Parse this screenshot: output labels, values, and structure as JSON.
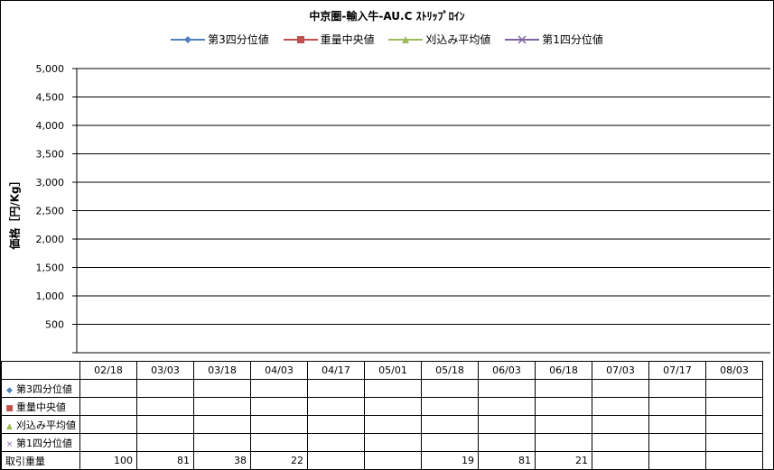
{
  "chart_data": {
    "type": "line",
    "title": "中京圏-輸入牛-AU.C ｽﾄﾘｯﾌﾟﾛｲﾝ",
    "ylabel": "価格［円/Kg］",
    "ylim": [
      0,
      5000
    ],
    "yticks": [
      500,
      1000,
      1500,
      2000,
      2500,
      3000,
      3500,
      4000,
      4500,
      5000
    ],
    "yticks_labels": [
      "500",
      "1,000",
      "1,500",
      "2,000",
      "2,500",
      "3,000",
      "3,500",
      "4,000",
      "4,500",
      "5,000"
    ],
    "categories": [
      "02/18",
      "03/03",
      "03/18",
      "04/03",
      "04/17",
      "05/01",
      "05/18",
      "06/03",
      "06/18",
      "07/03",
      "07/17",
      "08/03"
    ],
    "series": [
      {
        "name": "第3四分位値",
        "color": "#4F81BD",
        "marker": "◆",
        "values": [
          null,
          null,
          null,
          null,
          null,
          null,
          null,
          null,
          null,
          null,
          null,
          null
        ]
      },
      {
        "name": "重量中央値",
        "color": "#C0504D",
        "marker": "■",
        "values": [
          null,
          null,
          null,
          null,
          null,
          null,
          null,
          null,
          null,
          null,
          null,
          null
        ]
      },
      {
        "name": "刈込み平均値",
        "color": "#9BBB59",
        "marker": "▲",
        "values": [
          null,
          null,
          null,
          null,
          null,
          null,
          null,
          null,
          null,
          null,
          null,
          null
        ]
      },
      {
        "name": "第1四分位値",
        "color": "#8064A2",
        "marker": "×",
        "values": [
          null,
          null,
          null,
          null,
          null,
          null,
          null,
          null,
          null,
          null,
          null,
          null
        ]
      }
    ],
    "volume": {
      "name": "取引重量",
      "values": [
        "100",
        "81",
        "38",
        "22",
        "",
        "",
        "19",
        "81",
        "21",
        "",
        "",
        ""
      ]
    },
    "grid": true,
    "legend": "top"
  }
}
